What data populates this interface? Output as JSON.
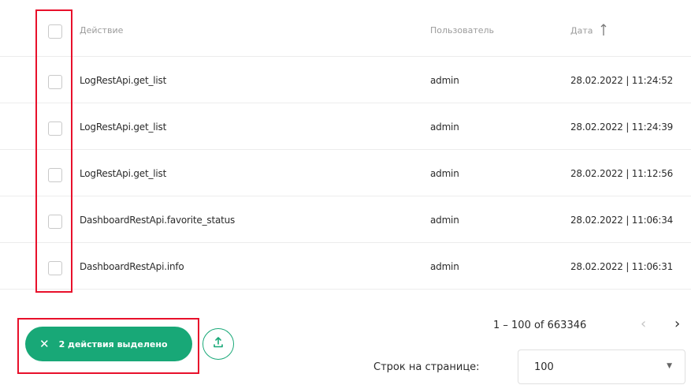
{
  "table": {
    "columns": {
      "action": "Действие",
      "user": "Пользователь",
      "date": "Дата"
    },
    "rows": [
      {
        "action": "LogRestApi.get_list",
        "user": "admin",
        "date": "28.02.2022 | 11:24:52"
      },
      {
        "action": "LogRestApi.get_list",
        "user": "admin",
        "date": "28.02.2022 | 11:24:39"
      },
      {
        "action": "LogRestApi.get_list",
        "user": "admin",
        "date": "28.02.2022 | 11:12:56"
      },
      {
        "action": "DashboardRestApi.favorite_status",
        "user": "admin",
        "date": "28.02.2022 | 11:06:34"
      },
      {
        "action": "DashboardRestApi.info",
        "user": "admin",
        "date": "28.02.2022 | 11:06:31"
      }
    ]
  },
  "footer": {
    "selected_label": "2 действия выделено",
    "pagination_range": "1 – 100 of 663346",
    "rows_per_page_label": "Строк на странице:",
    "rows_per_page_value": "100"
  },
  "icons": {
    "sort": "arrow-up-icon",
    "close": "close-icon",
    "export": "upload-icon",
    "prev": "chevron-left-icon",
    "next": "chevron-right-icon",
    "dropdown": "caret-down-icon"
  },
  "colors": {
    "accent": "#18a877",
    "highlight": "#e8102b"
  }
}
